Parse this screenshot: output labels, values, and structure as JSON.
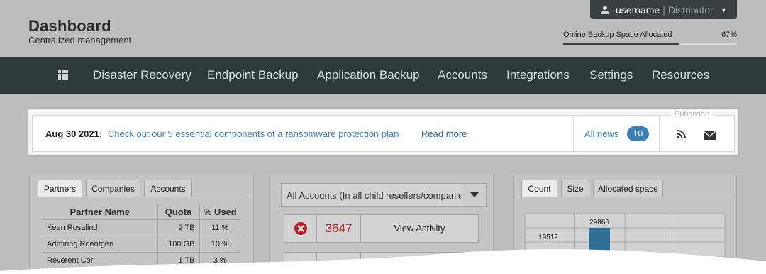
{
  "header": {
    "title": "Dashboard",
    "subtitle": "Centralized management"
  },
  "user": {
    "name": "username",
    "separator": "|",
    "role": "Distributor",
    "caret": "▼"
  },
  "backup": {
    "label": "Online Backup Space Allocated",
    "percent_text": "67%",
    "percent": 67
  },
  "nav": {
    "items": [
      "Disaster Recovery",
      "Endpoint Backup",
      "Application Backup",
      "Accounts",
      "Integrations",
      "Settings",
      "Resources"
    ]
  },
  "news": {
    "date": "Aug 30 2021:",
    "text": "Check out our 5 essential components of a ransomware protection plan",
    "read_more": "Read more",
    "all_news": "All news",
    "count": "10",
    "subscribe": "Subscribe"
  },
  "partners_panel": {
    "tabs": [
      "Partners",
      "Companies",
      "Accounts"
    ],
    "columns": [
      "Partner Name",
      "Quota",
      "% Used"
    ],
    "rows": [
      {
        "name": "Keen Rosalind",
        "quota": "2 TB",
        "used": "11 %"
      },
      {
        "name": "Admiring Roentgen",
        "quota": "100 GB",
        "used": "10 %"
      },
      {
        "name": "Reverent Cori",
        "quota": "1 TB",
        "used": "3 %"
      }
    ]
  },
  "activity_panel": {
    "selected": "All Accounts (In all child resellers/companies)",
    "error_count": "3647",
    "view_activity": "View Activity"
  },
  "chart_panel": {
    "tabs": [
      "Count",
      "Size",
      "Allocated space"
    ]
  },
  "chart_data": {
    "type": "bar",
    "values": [
      19512,
      29865
    ],
    "data_labels": [
      "19512",
      "29865"
    ]
  },
  "colors": {
    "nav_bg": "#2e3a3a",
    "accent_blue": "#3b7fb5",
    "error_red": "#b22222",
    "bar_blue": "#2f6f94"
  }
}
